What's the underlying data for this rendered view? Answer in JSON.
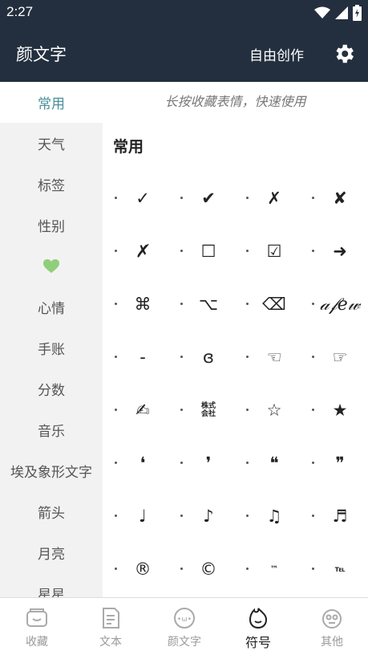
{
  "status": {
    "time": "2:27"
  },
  "appbar": {
    "title": "颜文字",
    "action": "自由创作"
  },
  "sidebar": {
    "items": [
      {
        "label": "常用",
        "active": true
      },
      {
        "label": "天气"
      },
      {
        "label": "标签"
      },
      {
        "label": "性别"
      },
      {
        "label": "💚"
      },
      {
        "label": "心情"
      },
      {
        "label": "手账"
      },
      {
        "label": "分数"
      },
      {
        "label": "音乐"
      },
      {
        "label": "埃及象形文字"
      },
      {
        "label": "箭头"
      },
      {
        "label": "月亮"
      },
      {
        "label": "星星"
      }
    ]
  },
  "main": {
    "hint": "长按收藏表情，快速使用",
    "section_title": "常用",
    "symbols": [
      [
        "✓",
        "✔",
        "✗",
        "✘"
      ],
      [
        "✗̸",
        "☐",
        "☑",
        "➜"
      ],
      [
        "⌘",
        "⌥",
        "⌫",
        "𝒶𝒻𝑒𝓌"
      ],
      [
        "-",
        "ɞ",
        "☜",
        "☞"
      ],
      [
        "✍",
        "株式会社",
        "☆",
        "★"
      ],
      [
        "❛",
        "❜",
        "❝",
        "❞"
      ],
      [
        "♩",
        "♪",
        "♫",
        "♬"
      ],
      [
        "®",
        "©",
        "™",
        "℡"
      ]
    ]
  },
  "bottom_nav": {
    "items": [
      {
        "label": "收藏",
        "icon": "favorites-icon"
      },
      {
        "label": "文本",
        "icon": "text-icon"
      },
      {
        "label": "颜文字",
        "icon": "kaomoji-icon"
      },
      {
        "label": "符号",
        "icon": "symbol-flame-icon",
        "active": true
      },
      {
        "label": "其他",
        "icon": "other-face-icon"
      }
    ]
  },
  "colors": {
    "header_bg": "#232f3e",
    "active_tab": "#4a8f9a",
    "sidebar_bg": "#f2f2f2"
  }
}
